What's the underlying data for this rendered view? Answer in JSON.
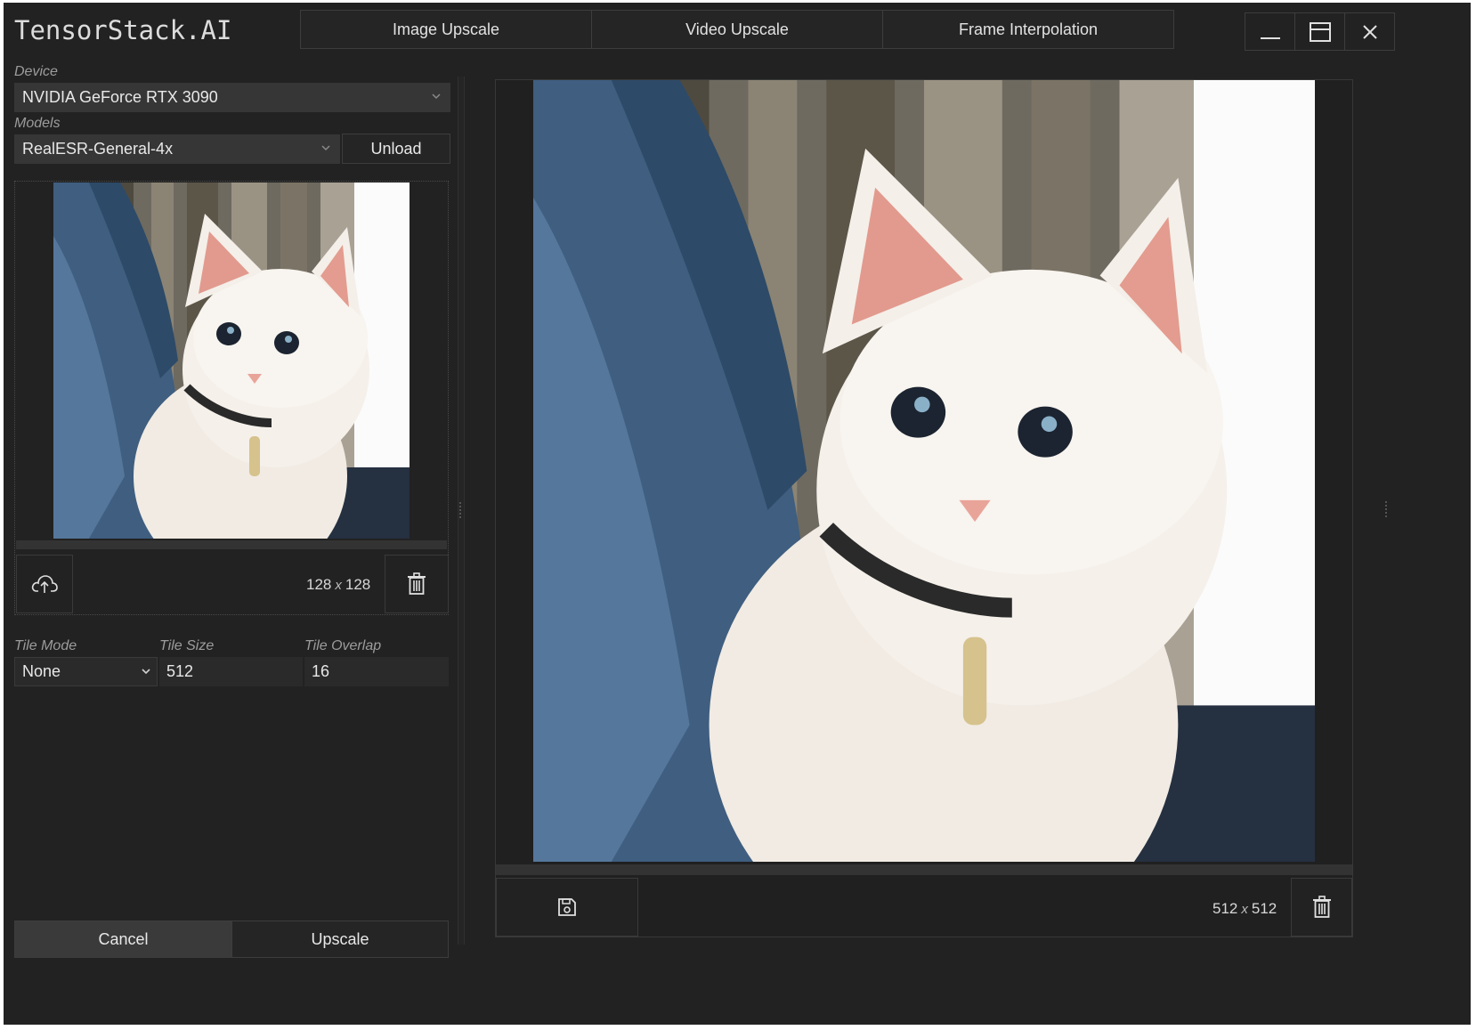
{
  "app": {
    "title": "TensorStack.AI"
  },
  "tabs": [
    {
      "label": "Image Upscale"
    },
    {
      "label": "Video Upscale"
    },
    {
      "label": "Frame Interpolation"
    }
  ],
  "window_controls": [
    "minimize-icon",
    "maximize-icon",
    "close-icon"
  ],
  "device": {
    "label": "Device",
    "value": "NVIDIA GeForce RTX 3090"
  },
  "models": {
    "label": "Models",
    "value": "RealESR-General-4x",
    "unload_label": "Unload"
  },
  "input_image": {
    "dimensions_w": "128",
    "dimensions_x": "x",
    "dimensions_h": "128",
    "icons": [
      "upload-cloud-icon",
      "trash-icon"
    ]
  },
  "tile": {
    "mode_label": "Tile Mode",
    "mode_value": "None",
    "size_label": "Tile Size",
    "size_value": "512",
    "overlap_label": "Tile Overlap",
    "overlap_value": "16"
  },
  "actions": {
    "cancel_label": "Cancel",
    "upscale_label": "Upscale"
  },
  "output_image": {
    "dimensions_w": "512",
    "dimensions_x": "x",
    "dimensions_h": "512",
    "icons": [
      "save-icon",
      "trash-icon"
    ]
  }
}
